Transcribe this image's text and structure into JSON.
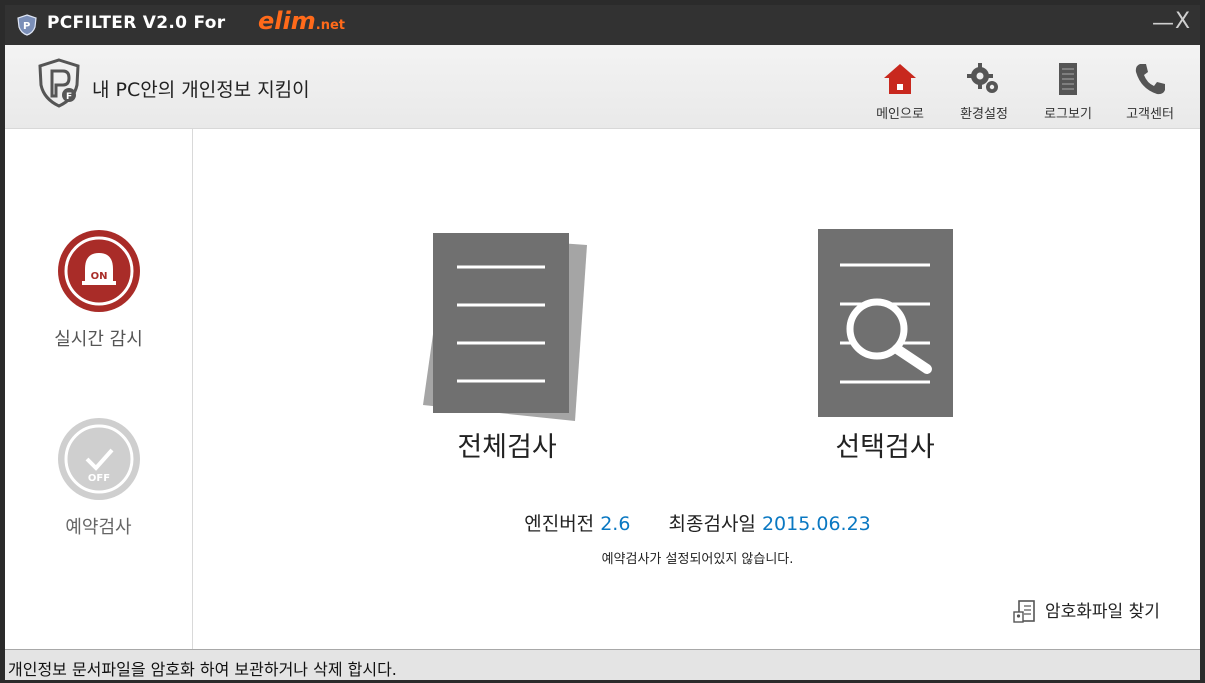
{
  "titlebar": {
    "title": "PCFILTER V2.0 For",
    "brand": "elim",
    "brand_suffix": ".net",
    "minimize": "—",
    "close": "X"
  },
  "header": {
    "title": "내 PC안의 개인정보 지킴이",
    "nav": [
      {
        "label": "메인으로",
        "icon": "home-icon",
        "color": "#c8281e"
      },
      {
        "label": "환경설정",
        "icon": "gear-icon"
      },
      {
        "label": "로그보기",
        "icon": "log-icon"
      },
      {
        "label": "고객센터",
        "icon": "phone-icon"
      }
    ]
  },
  "sidebar": {
    "realtime": {
      "label": "실시간 감시",
      "badge": "ON",
      "color": "#a92c28"
    },
    "scheduled": {
      "label": "예약검사",
      "badge": "OFF"
    }
  },
  "main": {
    "full_scan": {
      "label": "전체검사"
    },
    "select_scan": {
      "label": "선택검사"
    },
    "engine_label": "엔진버전",
    "engine_value": "2.6",
    "last_scan_label": "최종검사일",
    "last_scan_value": "2015.06.23",
    "schedule_note": "예약검사가 설정되어있지 않습니다.",
    "find_encrypted": "암호화파일 찾기"
  },
  "status": {
    "text": "개인정보 문서파일을 암호화 하여 보관하거나 삭제 합시다."
  }
}
